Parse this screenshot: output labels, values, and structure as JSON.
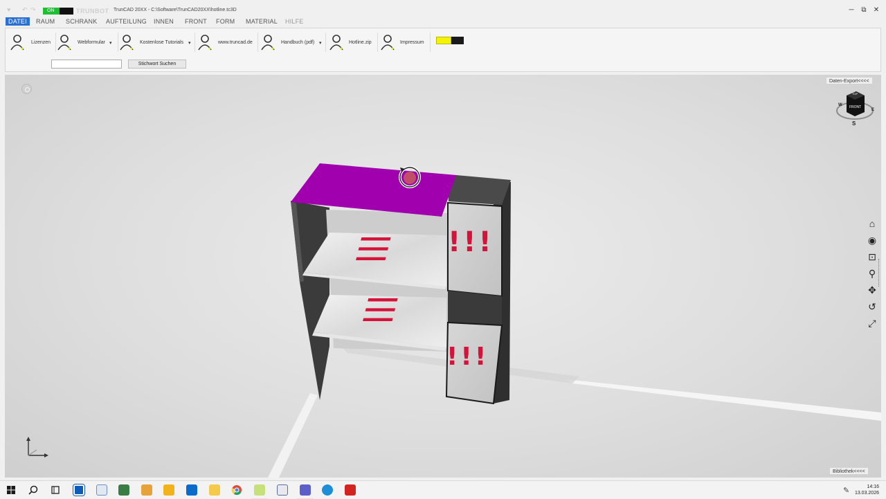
{
  "titlebar": {
    "brand": "TRUNBOT",
    "toggle_state": "ON",
    "window_title": "TrunCAD 20XX - C:\\Software\\TrunCAD20XX\\hotline.tc3D",
    "minimize_glyph": "─",
    "maximize_glyph": "⧉",
    "close_glyph": "✕"
  },
  "menu": {
    "items": [
      "DATEI",
      "RAUM",
      "SCHRANK",
      "AUFTEILUNG",
      "INNEN",
      "FRONT",
      "FORM",
      "MATERIAL",
      "HILFE"
    ],
    "active_index": 0
  },
  "ribbon": {
    "items": [
      {
        "label": "Lizenzen",
        "dropdown": false
      },
      {
        "label": "Webformular",
        "dropdown": true
      },
      {
        "label": "Kostenlose Tutorials",
        "dropdown": true
      },
      {
        "label": "www.truncad.de",
        "dropdown": false
      },
      {
        "label": "Handbuch (pdf)",
        "dropdown": true
      },
      {
        "label": "Hotline.zip",
        "dropdown": false
      },
      {
        "label": "Impressum",
        "dropdown": false
      }
    ],
    "dropdown_glyph": "▾",
    "search": {
      "value": "",
      "placeholder": ""
    },
    "search_button": "Stichwort Suchen",
    "swatch_colors": [
      "#f4f400",
      "#1a1a1a"
    ]
  },
  "viewport": {
    "data_export_button": "Daten-Export<<<<",
    "library_button": "Bibliothek<<<<",
    "viewcube": {
      "top": "TOP",
      "front": "FRONT",
      "west": "W",
      "east": "E",
      "south": "S"
    },
    "nav_tools": [
      "home-icon",
      "orbit-icon",
      "zoom-window-icon",
      "zoom-icon",
      "pan-icon",
      "rotate-icon",
      "fit-all-icon"
    ],
    "nav_glyphs": [
      "⌂",
      "◉",
      "⊡",
      "⚲",
      "✥",
      "↺",
      "⤢"
    ],
    "shelf_marks": {
      "list": "☰",
      "alert": "!!!"
    },
    "colors": {
      "selected_top": "#a000ad",
      "carcass": "#3a3a3a",
      "mark_red": "#d4123a"
    }
  },
  "taskbar": {
    "icons": [
      "windows-start-icon",
      "search-icon",
      "task-view-icon",
      "teamviewer-icon",
      "notepad-icon",
      "calculator-icon",
      "tool-icon",
      "rocket-icon",
      "outlook-icon",
      "explorer-icon",
      "chrome-icon",
      "truncad-icon",
      "pen-app-icon",
      "teams-icon",
      "edge-icon",
      "acrobat-icon"
    ],
    "time": "14:16",
    "date": "13.03.2026"
  }
}
